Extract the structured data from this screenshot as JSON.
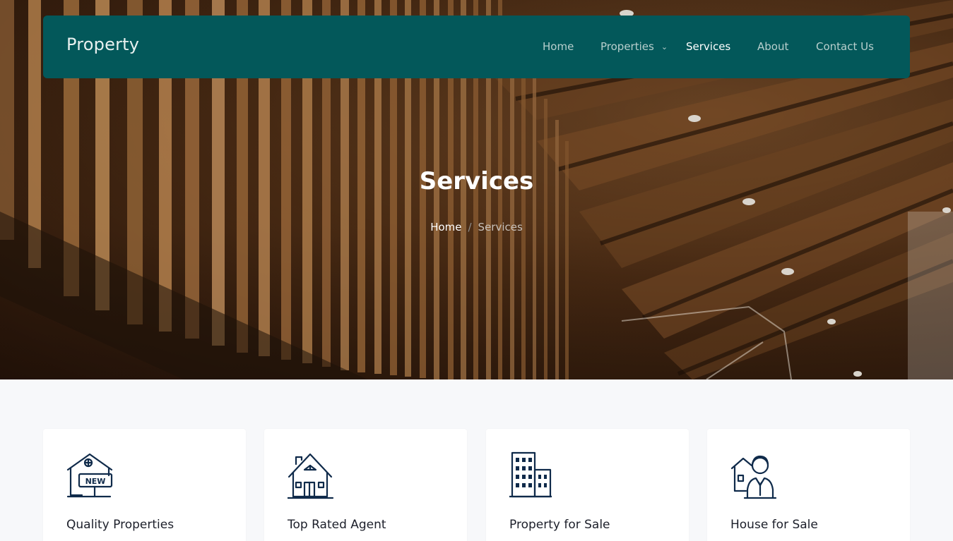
{
  "brand": {
    "name": "Property"
  },
  "nav": {
    "items": [
      {
        "label": "Home",
        "active": false
      },
      {
        "label": "Properties",
        "active": false,
        "has_dropdown": true
      },
      {
        "label": "Services",
        "active": true
      },
      {
        "label": "About",
        "active": false
      },
      {
        "label": "Contact Us",
        "active": false
      }
    ]
  },
  "hero": {
    "title": "Services",
    "breadcrumb": {
      "home": "Home",
      "separator": "/",
      "current": "Services"
    }
  },
  "services": {
    "cards": [
      {
        "title": "Quality Properties",
        "icon": "new-house-icon",
        "badge": "NEW"
      },
      {
        "title": "Top Rated Agent",
        "icon": "house-icon"
      },
      {
        "title": "Property for Sale",
        "icon": "building-icon"
      },
      {
        "title": "House for Sale",
        "icon": "agent-house-icon"
      }
    ]
  },
  "colors": {
    "navbar": "#03585a",
    "icon_stroke": "#0f2a4a",
    "section_bg": "#f7f8fa"
  }
}
